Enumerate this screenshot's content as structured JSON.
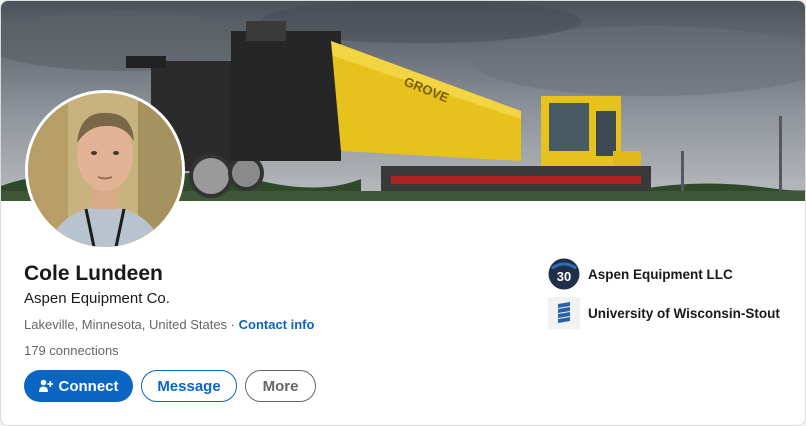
{
  "profile": {
    "name": "Cole Lundeen",
    "headline": "Aspen Equipment Co.",
    "location": "Lakeville, Minnesota, United States",
    "separator": " · ",
    "contact_info": "Contact info",
    "connections": "179 connections"
  },
  "actions": {
    "connect": "Connect",
    "message": "Message",
    "more": "More"
  },
  "orgs": [
    {
      "name": "Aspen Equipment LLC",
      "logo_text": "30",
      "icon": "aspen-equipment-logo"
    },
    {
      "name": "University of Wisconsin-Stout",
      "icon": "uw-stout-logo"
    }
  ],
  "colors": {
    "accent": "#0a66c2",
    "crane_yellow": "#e8c21c",
    "sky": "#5f6670"
  },
  "banner": {
    "crane_brand": "GROVE"
  }
}
